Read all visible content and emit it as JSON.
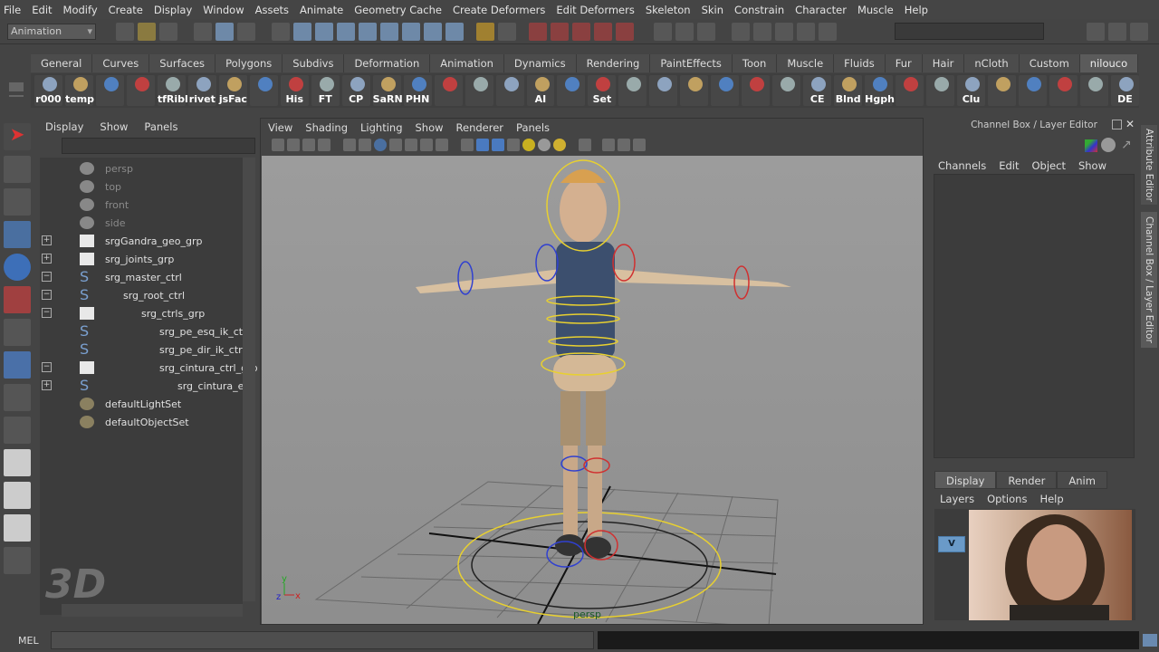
{
  "menu": [
    "File",
    "Edit",
    "Modify",
    "Create",
    "Display",
    "Window",
    "Assets",
    "Animate",
    "Geometry Cache",
    "Create Deformers",
    "Edit Deformers",
    "Skeleton",
    "Skin",
    "Constrain",
    "Character",
    "Muscle",
    "Help"
  ],
  "status": {
    "menu_set": "Animation"
  },
  "shelf_tabs": [
    "General",
    "Curves",
    "Surfaces",
    "Polygons",
    "Subdivs",
    "Deformation",
    "Animation",
    "Dynamics",
    "Rendering",
    "PaintEffects",
    "Toon",
    "Muscle",
    "Fluids",
    "Fur",
    "Hair",
    "nCloth",
    "Custom",
    "nilouco"
  ],
  "shelf_active": "nilouco",
  "shelf_buttons": [
    "r000",
    "temp",
    "",
    "",
    "tfRibl",
    "rivet",
    "jsFac",
    "",
    "His",
    "FT",
    "CP",
    "SaRN",
    "PHN",
    "",
    "",
    "",
    "AI",
    "",
    "Set",
    "",
    "",
    "",
    "",
    "",
    "",
    "CE",
    "Blnd",
    "Hgph",
    "",
    "",
    "Clu",
    "",
    "",
    "",
    "",
    "DE"
  ],
  "outliner": {
    "menu": [
      "Display",
      "Show",
      "Panels"
    ],
    "items": [
      {
        "label": "persp",
        "type": "camera",
        "dim": true,
        "indent": 0,
        "pm": ""
      },
      {
        "label": "top",
        "type": "camera",
        "dim": true,
        "indent": 0,
        "pm": ""
      },
      {
        "label": "front",
        "type": "camera",
        "dim": true,
        "indent": 0,
        "pm": ""
      },
      {
        "label": "side",
        "type": "camera",
        "dim": true,
        "indent": 0,
        "pm": ""
      },
      {
        "label": "srgGandra_geo_grp",
        "type": "group",
        "indent": 0,
        "pm": "+"
      },
      {
        "label": "srg_joints_grp",
        "type": "group",
        "indent": 0,
        "pm": "+"
      },
      {
        "label": "srg_master_ctrl",
        "type": "curve",
        "indent": 0,
        "pm": "−"
      },
      {
        "label": "srg_root_ctrl",
        "type": "curve",
        "indent": 1,
        "pm": "−"
      },
      {
        "label": "srg_ctrls_grp",
        "type": "group",
        "indent": 2,
        "pm": "−"
      },
      {
        "label": "srg_pe_esq_ik_ctrl",
        "type": "curve",
        "indent": 3,
        "pm": ""
      },
      {
        "label": "srg_pe_dir_ik_ctrl",
        "type": "curve",
        "indent": 3,
        "pm": ""
      },
      {
        "label": "srg_cintura_ctrl_grp",
        "type": "group",
        "indent": 3,
        "pm": "−"
      },
      {
        "label": "srg_cintura_esq",
        "type": "curve",
        "indent": 4,
        "pm": "+"
      },
      {
        "label": "defaultLightSet",
        "type": "set",
        "indent": 0,
        "pm": ""
      },
      {
        "label": "defaultObjectSet",
        "type": "set",
        "indent": 0,
        "pm": ""
      }
    ]
  },
  "viewport": {
    "menu": [
      "View",
      "Shading",
      "Lighting",
      "Show",
      "Renderer",
      "Panels"
    ],
    "camera_label": "persp",
    "axis": {
      "y": "y",
      "z": "z",
      "x": "x"
    }
  },
  "channel_box": {
    "title": "Channel Box / Layer Editor",
    "menu": [
      "Channels",
      "Edit",
      "Object",
      "Show"
    ]
  },
  "layer_editor": {
    "tabs": [
      "Display",
      "Render",
      "Anim"
    ],
    "active": "Display",
    "menu": [
      "Layers",
      "Options",
      "Help"
    ],
    "layer_v": "V"
  },
  "side_tabs": [
    "Attribute Editor",
    "Channel Box / Layer Editor"
  ],
  "mel": {
    "label": "MEL"
  },
  "watermark": "3D"
}
